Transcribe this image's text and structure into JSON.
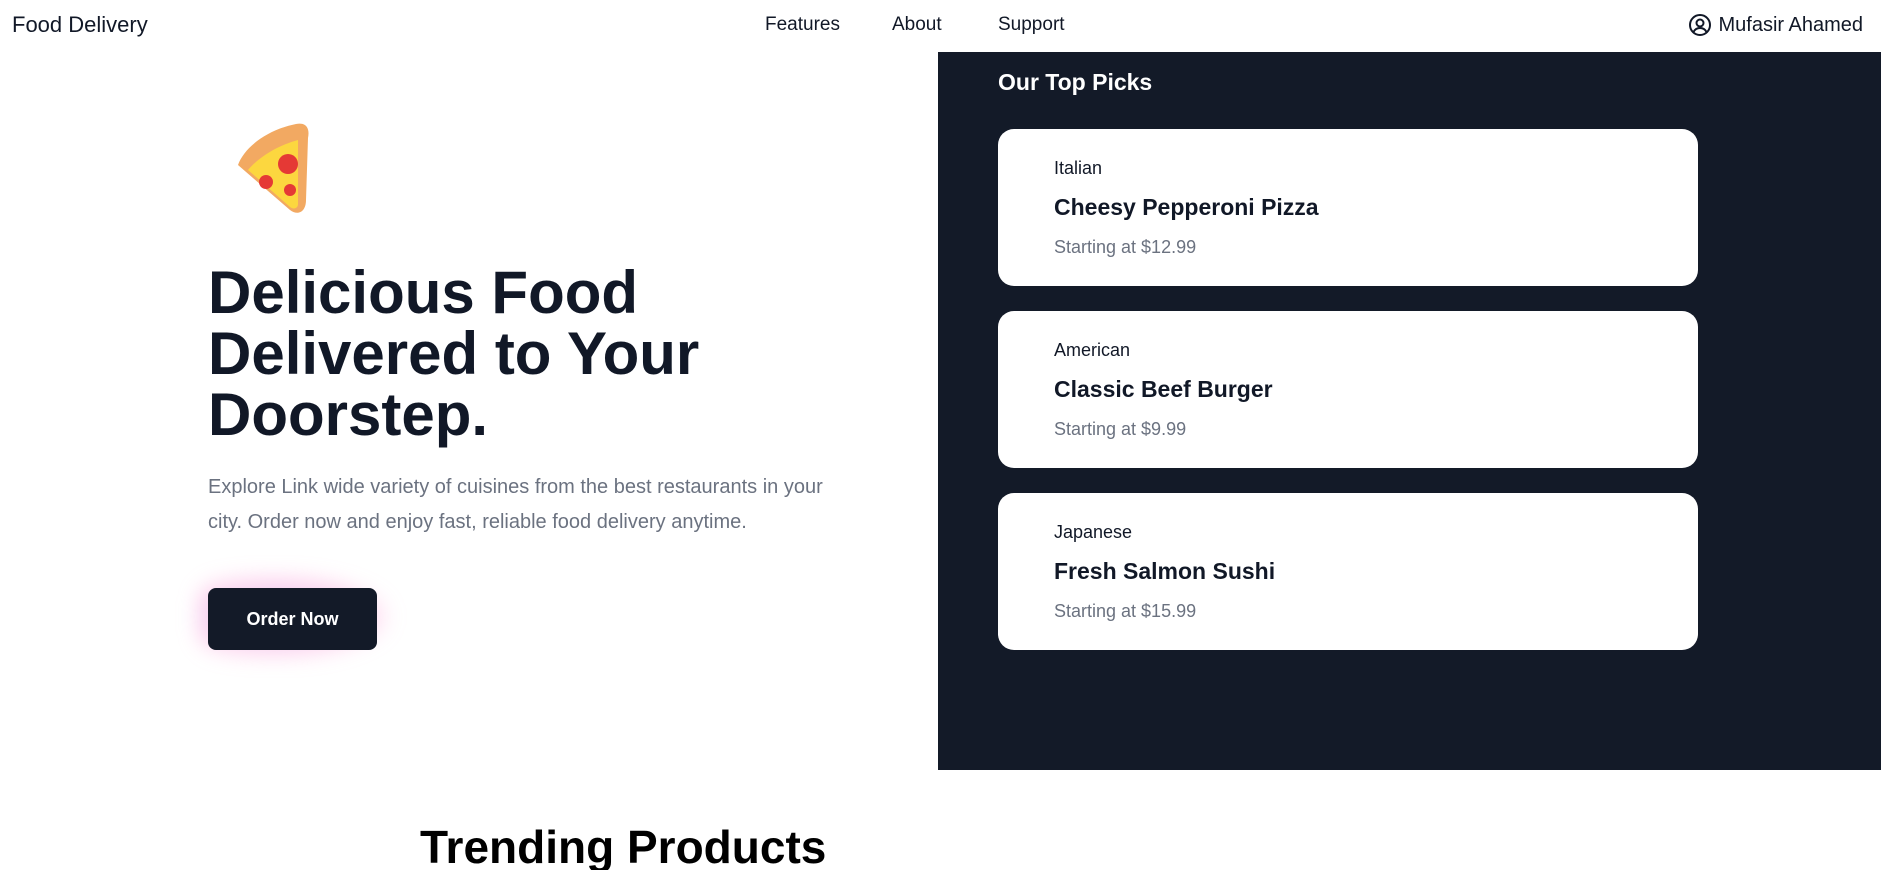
{
  "nav": {
    "brand": "Food Delivery",
    "links": [
      "Features",
      "About",
      "Support"
    ],
    "user": {
      "icon": "user-circle-icon",
      "name": "Mufasir Ahamed"
    }
  },
  "hero": {
    "icon": "pizza-icon",
    "title": "Delicious Food Delivered to Your Doorstep.",
    "description": "Explore Link wide variety of cuisines from the best restaurants in your city. Order now and enjoy fast, reliable food delivery anytime.",
    "cta_label": "Order Now"
  },
  "top_picks": {
    "title": "Our Top Picks",
    "items": [
      {
        "cuisine": "Italian",
        "name": "Cheesy Pepperoni Pizza",
        "price": "Starting at $12.99"
      },
      {
        "cuisine": "American",
        "name": "Classic Beef Burger",
        "price": "Starting at $9.99"
      },
      {
        "cuisine": "Japanese",
        "name": "Fresh Salmon Sushi",
        "price": "Starting at $15.99"
      }
    ]
  },
  "trending": {
    "title": "Trending Products"
  },
  "colors": {
    "dark": "#131a28",
    "text": "#111827",
    "muted": "#6b7280",
    "white": "#ffffff"
  }
}
